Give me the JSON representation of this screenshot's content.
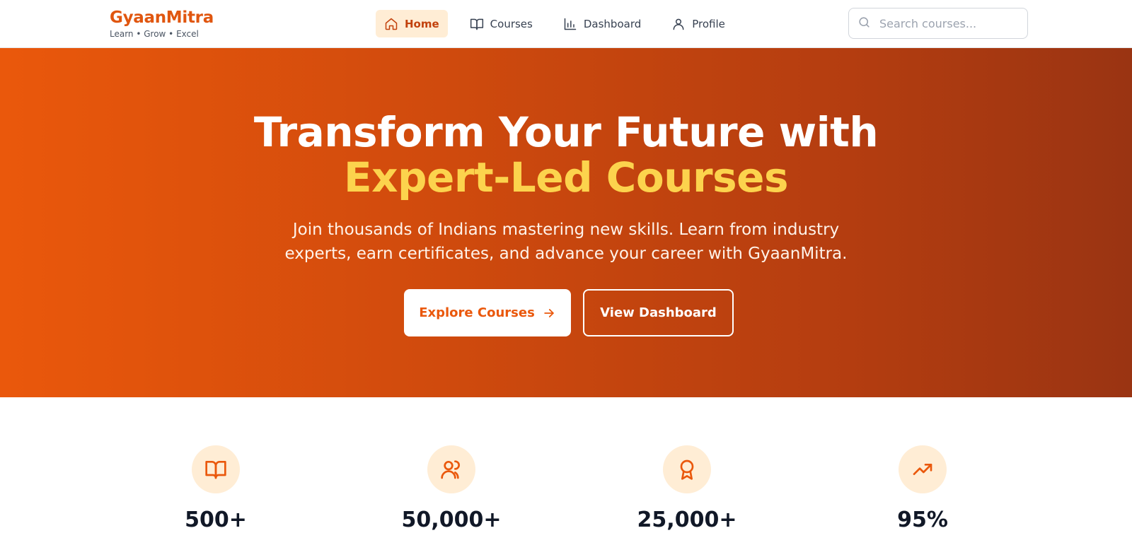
{
  "brand": {
    "name": "GyaanMitra",
    "tagline": "Learn • Grow • Excel"
  },
  "nav": {
    "items": [
      {
        "label": "Home",
        "icon": "home-icon",
        "active": true
      },
      {
        "label": "Courses",
        "icon": "book-icon",
        "active": false
      },
      {
        "label": "Dashboard",
        "icon": "bar-chart-icon",
        "active": false
      },
      {
        "label": "Profile",
        "icon": "user-icon",
        "active": false
      }
    ]
  },
  "search": {
    "placeholder": "Search courses...",
    "value": ""
  },
  "hero": {
    "title_line1": "Transform Your Future with",
    "title_line2": "Expert-Led Courses",
    "subtitle": "Join thousands of Indians mastering new skills. Learn from industry experts, earn certificates, and advance your career with GyaanMitra.",
    "primary_button": "Explore Courses",
    "secondary_button": "View Dashboard"
  },
  "stats": [
    {
      "value": "500+",
      "icon": "book-open-icon"
    },
    {
      "value": "50,000+",
      "icon": "users-icon"
    },
    {
      "value": "25,000+",
      "icon": "award-icon"
    },
    {
      "value": "95%",
      "icon": "trending-up-icon"
    }
  ],
  "colors": {
    "accent": "#ea580c",
    "highlight": "#fcd34d",
    "hero_end": "#9a3412"
  }
}
